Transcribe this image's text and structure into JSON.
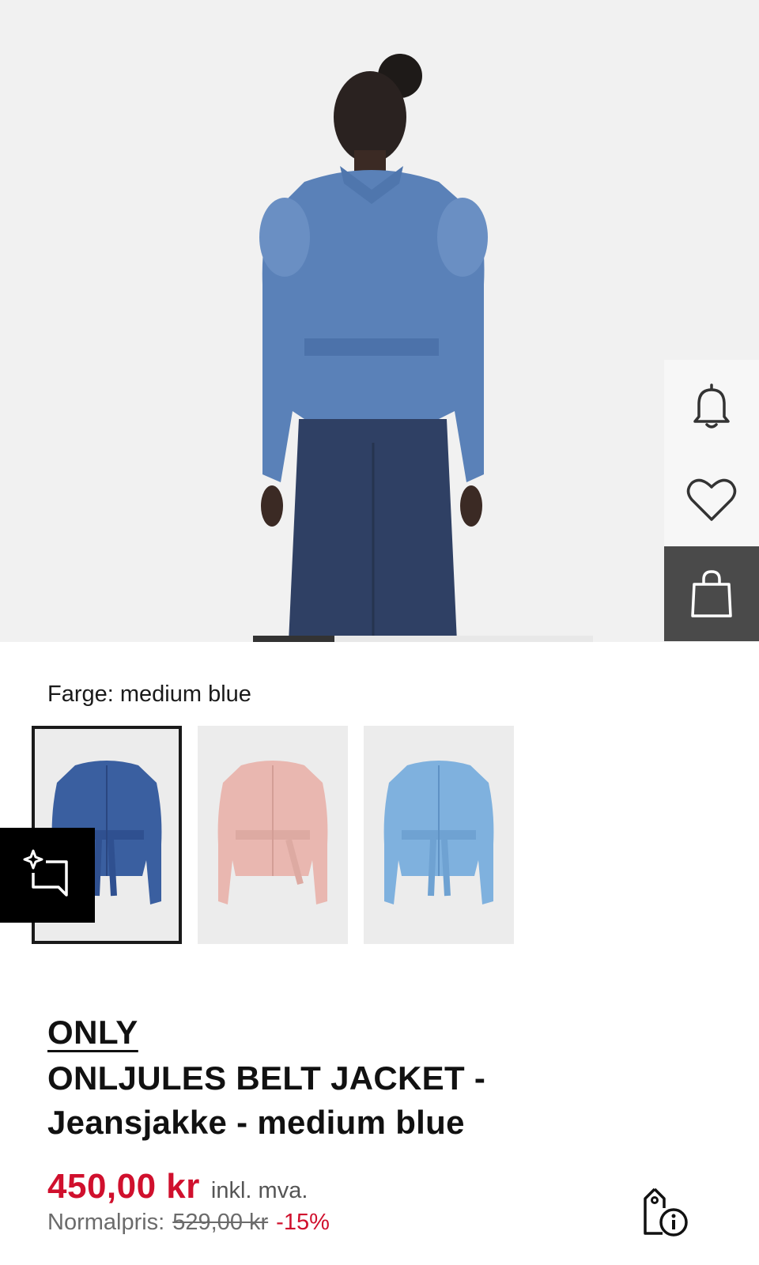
{
  "colors": {
    "accent_red": "#d0102d",
    "dark_rail": "#4a4a4a",
    "background": "#f1f1f1"
  },
  "hero": {
    "icon": "model-back-view-denim-jacket",
    "carousel_progress": 0.24
  },
  "rail": {
    "items": [
      {
        "name": "notify",
        "icon": "bell-icon"
      },
      {
        "name": "wishlist",
        "icon": "heart-icon"
      },
      {
        "name": "add-to-bag",
        "icon": "shopping-bag-icon"
      }
    ]
  },
  "color_section": {
    "label": "Farge: medium blue",
    "swatches": [
      {
        "name": "medium blue",
        "hex": "#3a5fa0",
        "selected": true
      },
      {
        "name": "pink",
        "hex": "#e9b7b0",
        "selected": false
      },
      {
        "name": "light blue",
        "hex": "#7fb1de",
        "selected": false
      }
    ]
  },
  "floating_button": {
    "icon": "sparkle-feedback-icon"
  },
  "product": {
    "brand": "ONLY",
    "title_line1": "ONLJULES BELT JACKET -",
    "title_line2": "Jeansjakke - medium blue",
    "price": "450,00 kr",
    "vat_label": "inkl. mva.",
    "normal_label": "Normalpris:",
    "normal_price": "529,00 kr",
    "discount": "-15%",
    "info_icon": "price-tag-info-icon"
  }
}
